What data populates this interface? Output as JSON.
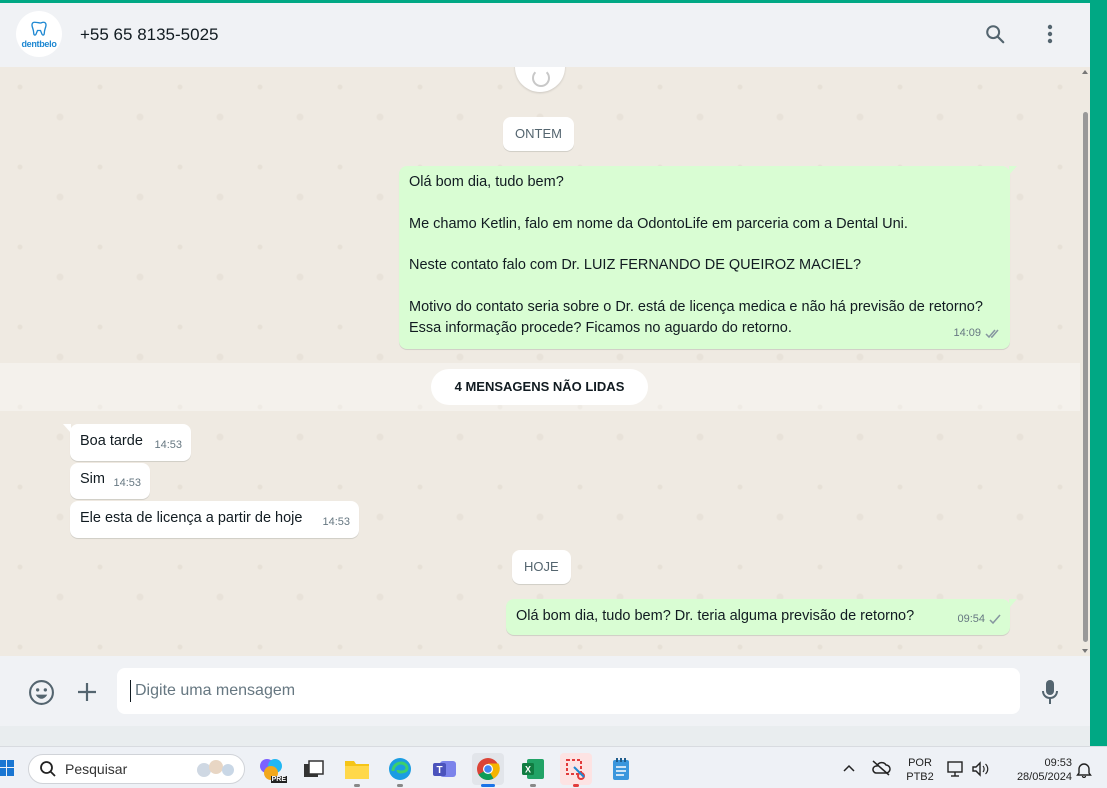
{
  "header": {
    "avatar_brand": "dentbelo",
    "contact_name": "+55 65 8135-5025",
    "search_icon": "search-icon",
    "menu_icon": "kebab-menu-icon"
  },
  "chat": {
    "date_yesterday": "ONTEM",
    "date_today": "HOJE",
    "unread_banner": "4 MENSAGENS NÃO LIDAS",
    "messages": [
      {
        "direction": "out",
        "text": "Olá bom dia, tudo bem?\n\nMe chamo Ketlin, falo em nome da OdontoLife em parceria com a Dental Uni.\n\nNeste contato falo com Dr. LUIZ FERNANDO DE QUEIROZ MACIEL?\n\nMotivo do contato seria sobre o Dr. está de licença medica e não há previsão de retorno? Essa informação procede? Ficamos no aguardo do retorno.",
        "time": "14:09",
        "status": "read"
      },
      {
        "direction": "in",
        "text": "Boa tarde",
        "time": "14:53"
      },
      {
        "direction": "in",
        "text": "Sim",
        "time": "14:53"
      },
      {
        "direction": "in",
        "text": "Ele esta de licença a partir de hoje",
        "time": "14:53"
      },
      {
        "direction": "out",
        "text": "Olá bom dia, tudo bem? Dr. teria alguma previsão de retorno?",
        "time": "09:54",
        "status": "sent"
      }
    ]
  },
  "composer": {
    "placeholder": "Digite uma mensagem",
    "emoji_icon": "emoji-icon",
    "attach_icon": "plus-icon",
    "mic_icon": "microphone-icon"
  },
  "taskbar": {
    "search_label": "Pesquisar",
    "language_line1": "POR",
    "language_line2": "PTB2",
    "clock_time": "09:53",
    "clock_date": "28/05/2024",
    "preview_badge": "PRE"
  },
  "colors": {
    "accent": "#00a884",
    "outgoing_bubble": "#d9fdd3",
    "incoming_bubble": "#ffffff",
    "chat_background": "#efeae2",
    "read_tick": "#53bdeb"
  }
}
